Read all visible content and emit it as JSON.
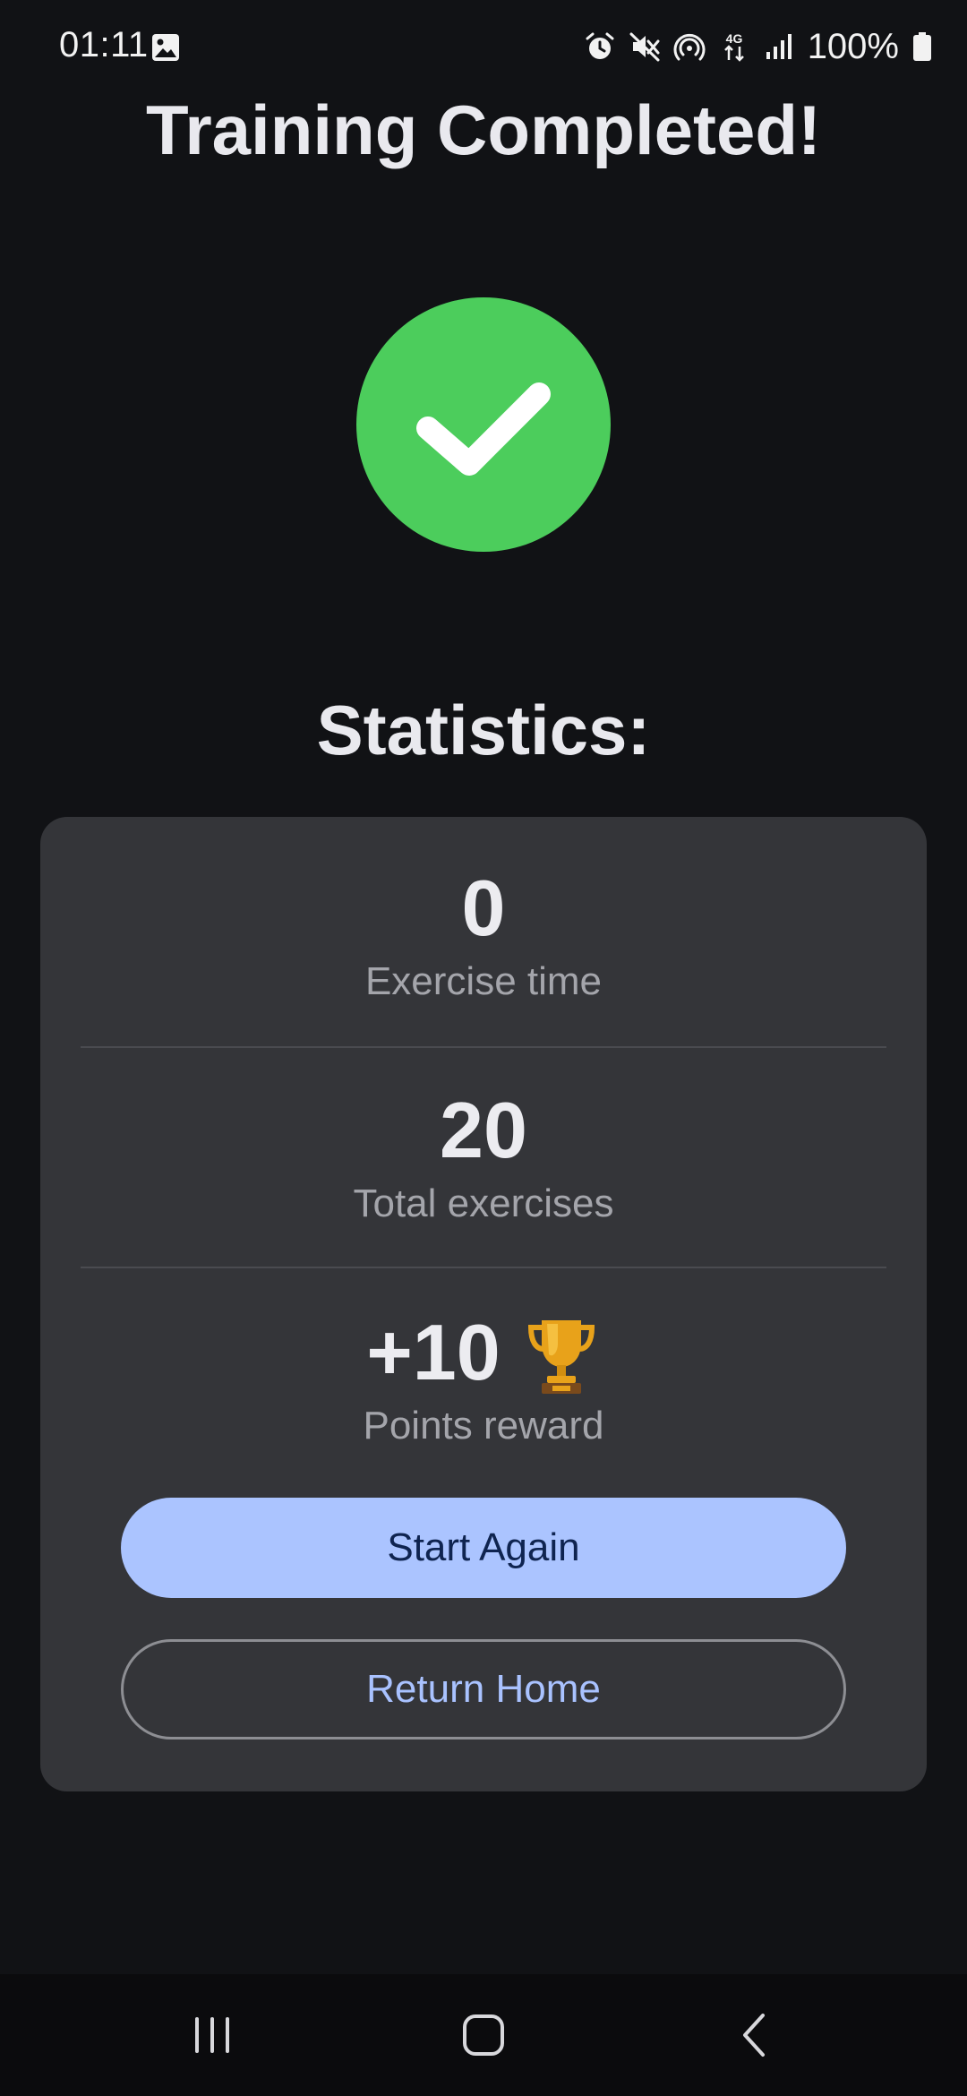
{
  "status_bar": {
    "time": "01:11",
    "battery": "100%",
    "icons": [
      "image-icon",
      "alarm-icon",
      "mute-icon",
      "hotspot-icon",
      "4g-icon",
      "signal-icon",
      "battery-icon"
    ]
  },
  "title": "Training Completed!",
  "success_icon": "check-icon",
  "colors": {
    "success": "#4ccd5c",
    "primary_button": "#abc4ff",
    "primary_button_text": "#0f2450",
    "secondary_button_text": "#a9c2ff",
    "card": "#343539",
    "background": "#111215"
  },
  "stats_heading": "Statistics:",
  "stats": [
    {
      "value": "0",
      "label": "Exercise time"
    },
    {
      "value": "20",
      "label": "Total exercises"
    },
    {
      "value": "+10",
      "label": "Points reward",
      "icon": "trophy-icon"
    }
  ],
  "buttons": {
    "start_again": "Start Again",
    "return_home": "Return Home"
  },
  "nav_bar": {
    "items": [
      "recent-apps-icon",
      "home-icon",
      "back-icon"
    ]
  }
}
